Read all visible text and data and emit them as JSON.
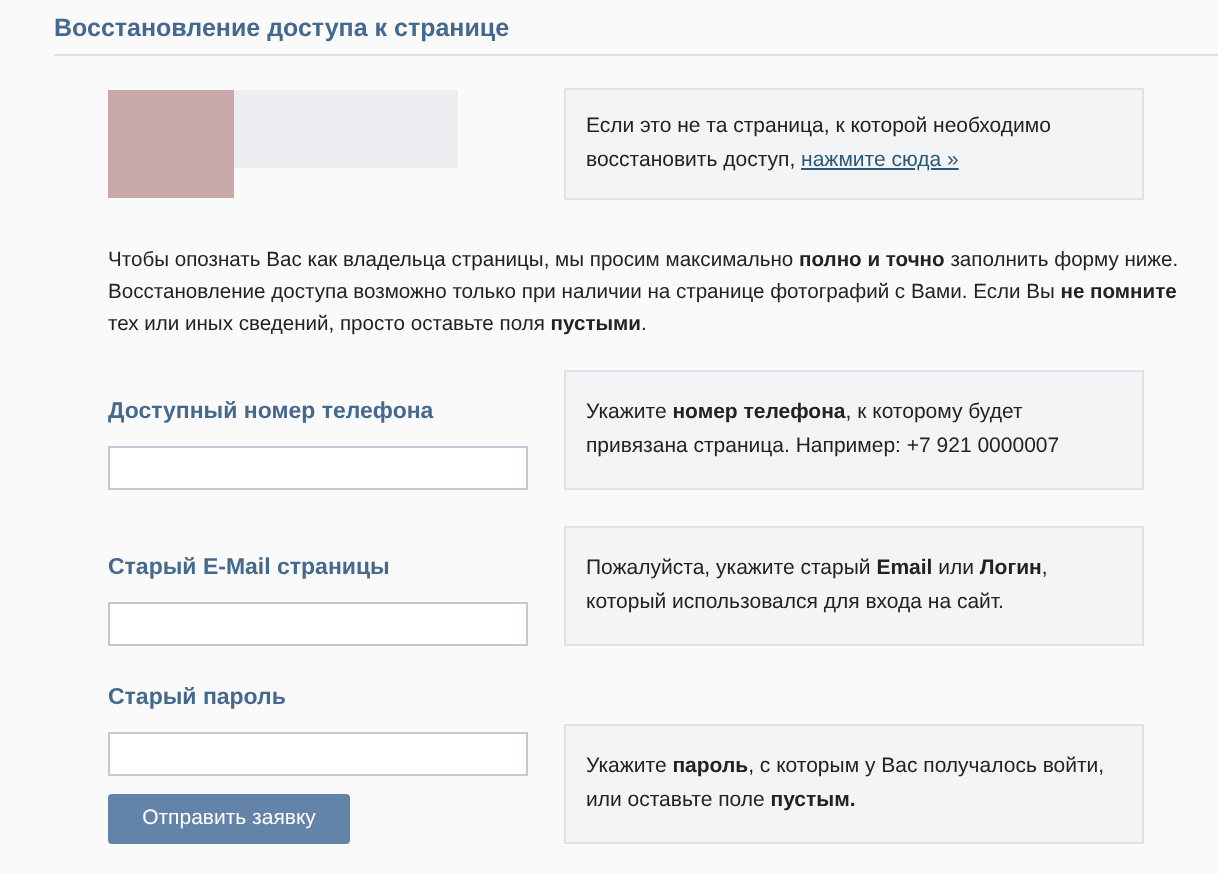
{
  "header": {
    "title": "Восстановление доступа к странице"
  },
  "notice": {
    "text": "Если это не та страница, к которой необходимо восстановить доступ,",
    "link": "нажмите сюда »"
  },
  "intro": "Чтобы опознать Вас как владельца страницы, мы просим максимально **полно и точно** заполнить форму ниже. Восстановление доступа возможно только при наличии на странице фотографий с Вами. Если Вы **не помните** тех или иных сведений, просто оставьте поля **пустыми**.",
  "fields": [
    {
      "label": "Доступный номер телефона",
      "hint": "Укажите **номер телефона**, к которому будет привязана страница. Например: +7 921 0000007"
    },
    {
      "label": "Старый E-Mail страницы",
      "hint": "Пожалуйста, укажите старый **Email** или **Логин**, который использовался для входа на сайт."
    },
    {
      "label": "Старый пароль",
      "hint": "Укажите **пароль**, с которым у Вас получалось войти, или оставьте поле **пустым.**"
    }
  ],
  "submit": "Отправить заявку"
}
